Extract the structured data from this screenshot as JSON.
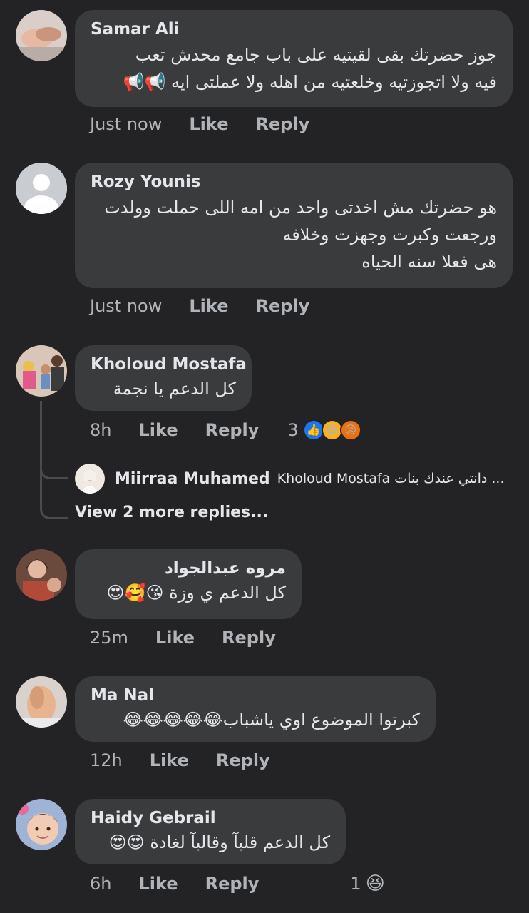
{
  "comments": [
    {
      "author": "Samar Ali",
      "lines": [
        "جوز حضرتك بقى لقيتيه على باب جامع محدش تعب",
        "فيه ولا اتجوزتيه وخلعتيه من اهله ولا عملتى ايه 📢📢"
      ],
      "time": "Just now",
      "like": "Like",
      "reply": "Reply"
    },
    {
      "author": "Rozy Younis",
      "lines": [
        "هو حضرتك مش اخدتى واحد من امه اللى حملت وولدت",
        "ورجعت وكبرت وجهزت وخلافه",
        "هى فعلا سنه الحياه"
      ],
      "time": "Just now",
      "like": "Like",
      "reply": "Reply"
    },
    {
      "author": "Kholoud Mostafa",
      "lines": [
        "كل الدعم يا نجمة"
      ],
      "time": "8h",
      "like": "Like",
      "reply": "Reply",
      "reaction_count": "3",
      "reaction_icons": [
        "like-reaction-icon",
        "haha-reaction-icon",
        "angry-reaction-icon"
      ]
    },
    {
      "author": "مروه عبدالجواد",
      "lines": [
        "كل الدعم ي وزة 😘🥰😍"
      ],
      "time": "25m",
      "like": "Like",
      "reply": "Reply"
    },
    {
      "author": "Ma Nal",
      "lines": [
        "كبرتوا الموضوع اوي ياشباب😂😂😂😂😂"
      ],
      "time": "12h",
      "like": "Like",
      "reply": "Reply"
    },
    {
      "author": "Haidy Gebrail",
      "lines": [
        "كل الدعم  قلبآ وقالبآ لغادة 😍😍"
      ],
      "time": "6h",
      "like": "Like",
      "reply": "Reply",
      "reaction_count": "1",
      "reaction_icons": [
        "haha-reaction-icon"
      ]
    }
  ],
  "reply_preview": {
    "author": "Miirraa Muhamed",
    "text": "Kholoud Mostafa دانتي عندك بنات ...",
    "view_more": "View 2 more replies..."
  },
  "colors": {
    "background": "#232325",
    "bubble": "#3a3b3c",
    "text": "#e4e6eb",
    "secondary": "#b0b3b8",
    "like_blue": "#1877f2",
    "haha_yellow": "#f7b125",
    "angry_orange": "#e9710f"
  }
}
